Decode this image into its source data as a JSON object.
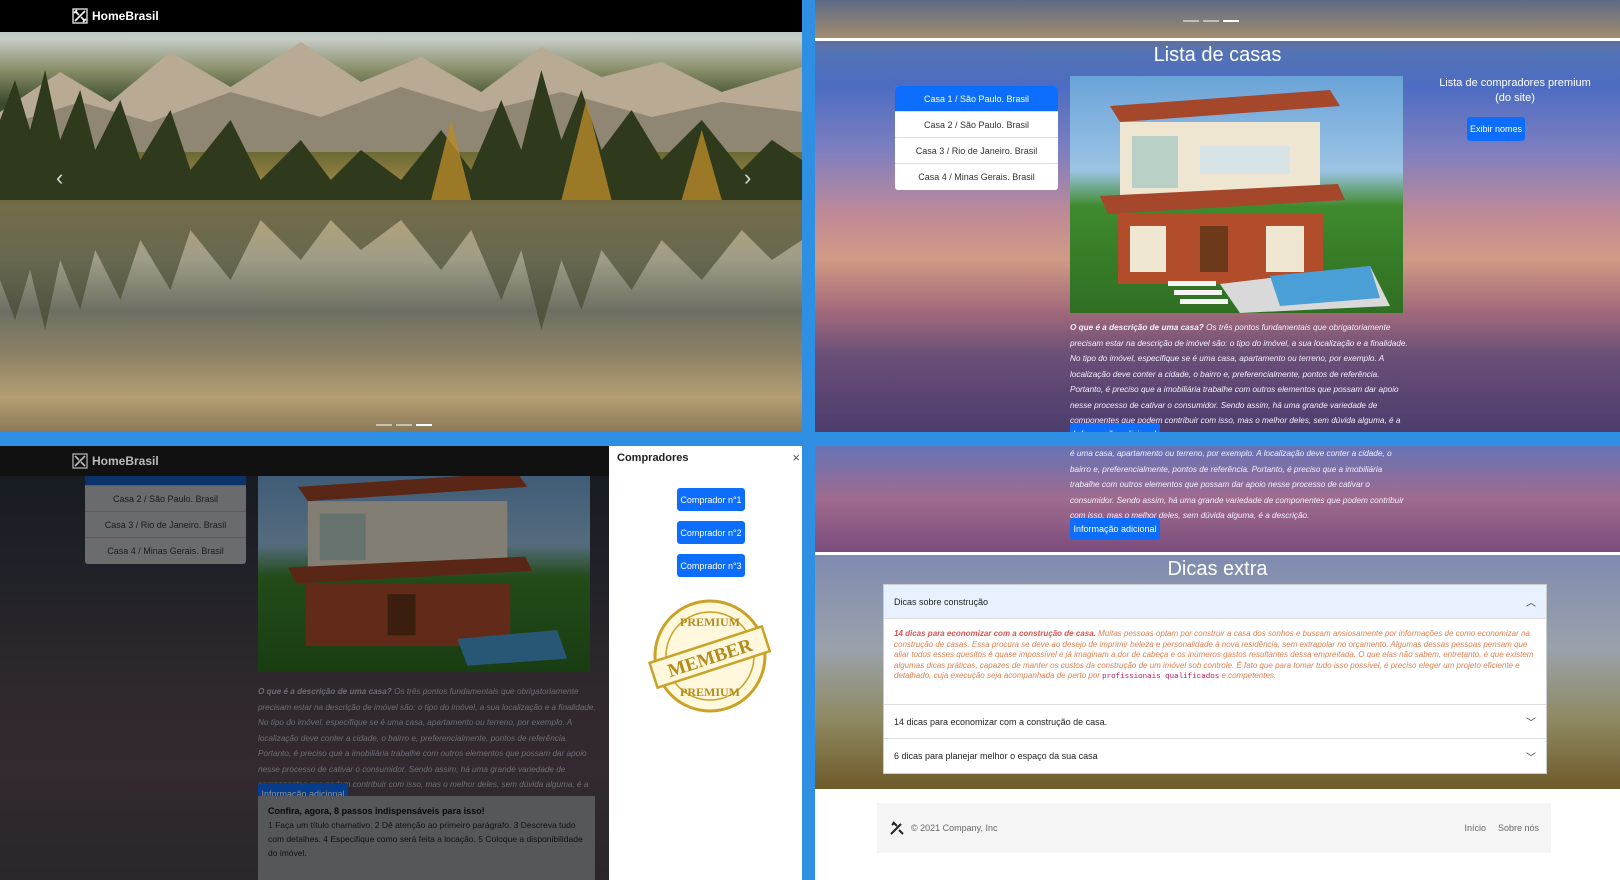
{
  "brand": {
    "name": "HomeBrasil"
  },
  "houses_section": {
    "title": "Lista de casas",
    "list": [
      "Casa 1 / São Paulo. Brasil",
      "Casa 2 / São Paulo. Brasil",
      "Casa 3 / Rio de Janeiro. Brasil",
      "Casa 4 / Minas Gerais. Brasil"
    ],
    "premium_title": "Lista de compradores premium (do site)",
    "premium_button": "Exibir nomes",
    "description_lead": "O que é a descrição de uma casa?",
    "description": "Os três pontos fundamentais que obrigatoriamente precisam estar na descrição de imóvel são: o tipo do imóvel, a sua localização e a finalidade. No tipo do imóvel, especifique se é uma casa, apartamento ou terreno, por exemplo. A localização deve conter a cidade, o bairro e, preferencialmente, pontos de referência. Portanto, é preciso que a imobiliária trabalhe com outros elementos que possam dar apoio nesse processo de cativar o consumidor. Sendo assim, há uma grande variedade de componentes que podem contribuir com isso, mas o melhor deles, sem dúvida alguma, é a descrição.",
    "info_button": "Informação adicional"
  },
  "buyers_panel": {
    "title": "Compradores",
    "close": "×",
    "buttons": [
      "Comprador n°1",
      "Comprador n°2",
      "Comprador n°3"
    ],
    "stamp_top": "PREMIUM",
    "stamp_mid": "MEMBER",
    "stamp_bottom": "PREMIUM"
  },
  "steps_card": {
    "title": "Confira, agora, 8 passos indispensáveis para isso!",
    "text": "1 Faça um título chamativo. 2 Dê atenção ao primeiro parágrafo. 3 Descreva tudo com detalhes. 4 Especifique como será feita a locação. 5 Coloque a disponibilidade do imóvel."
  },
  "p4_description": "é uma casa, apartamento ou terreno, por exemplo. A localização deve conter a cidade, o bairro e, preferencialmente, pontos de referência. Portanto, é preciso que a imobiliária trabalhe com outros elementos que possam dar apoio nesse processo de cativar o consumidor. Sendo assim, há uma grande variedade de componentes que podem contribuir com isso, mas o melhor deles, sem dúvida alguma, é a descrição.",
  "tips": {
    "title": "Dicas extra",
    "items": [
      {
        "title": "Dicas sobre construção"
      },
      {
        "title": "14 dicas para economizar com a construção de casa."
      },
      {
        "title": "6 dicas para planejar melhor o espaço da sua casa"
      }
    ],
    "body_lead": "14 dicas para economizar com a construção de casa.",
    "body_text": "Muitas pessoas optam por construir a casa dos sonhos e buscam ansiosamente por informações de como economizar na construção de casas. Essa procura se deve ao desejo de imprimir beleza e personalidade à nova residência, sem extrapolar no orçamento. Algumas dessas pessoas pensam que aliar todos esses quesitos é quase impossível e já imaginam a dor de cabeça e os inúmeros gastos resultantes dessa empreitada. O que elas não sabem, entretanto, é que existem algumas dicas práticas, capazes de manter os custos da construção de um imóvel sob controle. É fato que para tomar tudo isso possível, é preciso eleger um projeto eficiente e detalhado, cuja execução seja acompanhada de perto por",
    "body_code": "profissionais qualificados",
    "body_tail": "e competentes."
  },
  "footer": {
    "copyright": "© 2021 Company, Inc",
    "links": [
      "Início",
      "Sobre nós"
    ]
  },
  "colors": {
    "primary": "#0d6efd",
    "navbar": "#000000",
    "frame": "#2f8fe3"
  }
}
